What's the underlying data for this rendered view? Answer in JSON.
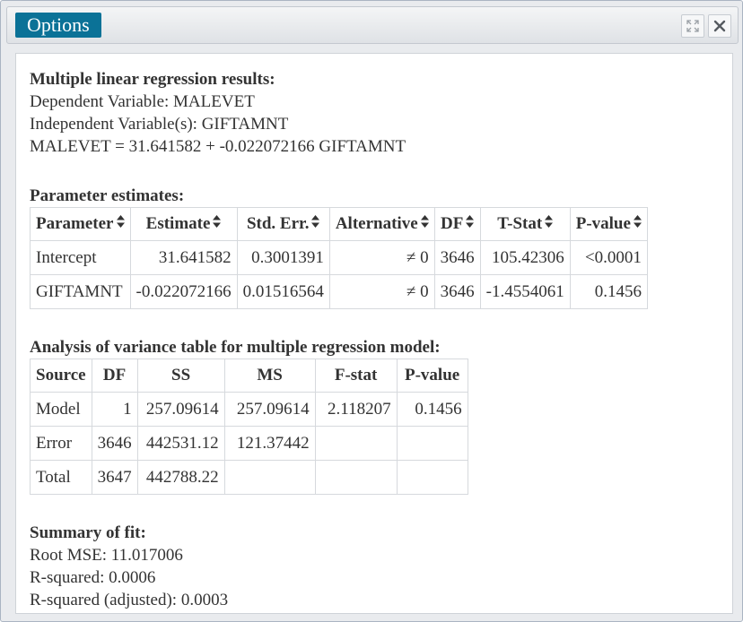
{
  "window": {
    "title": "Options",
    "icons": {
      "maximize": "expand-icon",
      "close": "close-icon"
    }
  },
  "regression": {
    "heading": "Multiple linear regression results:",
    "dependent": "Dependent Variable: MALEVET",
    "independent": "Independent Variable(s): GIFTAMNT",
    "equation": "MALEVET = 31.641582 + -0.022072166 GIFTAMNT"
  },
  "params": {
    "heading": "Parameter estimates:",
    "columns": [
      "Parameter",
      "Estimate",
      "Std. Err.",
      "Alternative",
      "DF",
      "T-Stat",
      "P-value"
    ],
    "rows": [
      [
        "Intercept",
        "31.641582",
        "0.3001391",
        "≠ 0",
        "3646",
        "105.42306",
        "<0.0001"
      ],
      [
        "GIFTAMNT",
        "-0.022072166",
        "0.01516564",
        "≠ 0",
        "3646",
        "-1.4554061",
        "0.1456"
      ]
    ]
  },
  "anova": {
    "heading": "Analysis of variance table for multiple regression model:",
    "columns": [
      "Source",
      "DF",
      "SS",
      "MS",
      "F-stat",
      "P-value"
    ],
    "rows": [
      [
        "Model",
        "1",
        "257.09614",
        "257.09614",
        "2.118207",
        "0.1456"
      ],
      [
        "Error",
        "3646",
        "442531.12",
        "121.37442",
        "",
        ""
      ],
      [
        "Total",
        "3647",
        "442788.22",
        "",
        "",
        ""
      ]
    ]
  },
  "fit": {
    "heading": "Summary of fit:",
    "root_mse": "Root MSE: 11.017006",
    "r_squared": "R-squared: 0.0006",
    "r_squared_adj": "R-squared (adjusted): 0.0003"
  },
  "colors": {
    "accent": "#0b7297"
  }
}
